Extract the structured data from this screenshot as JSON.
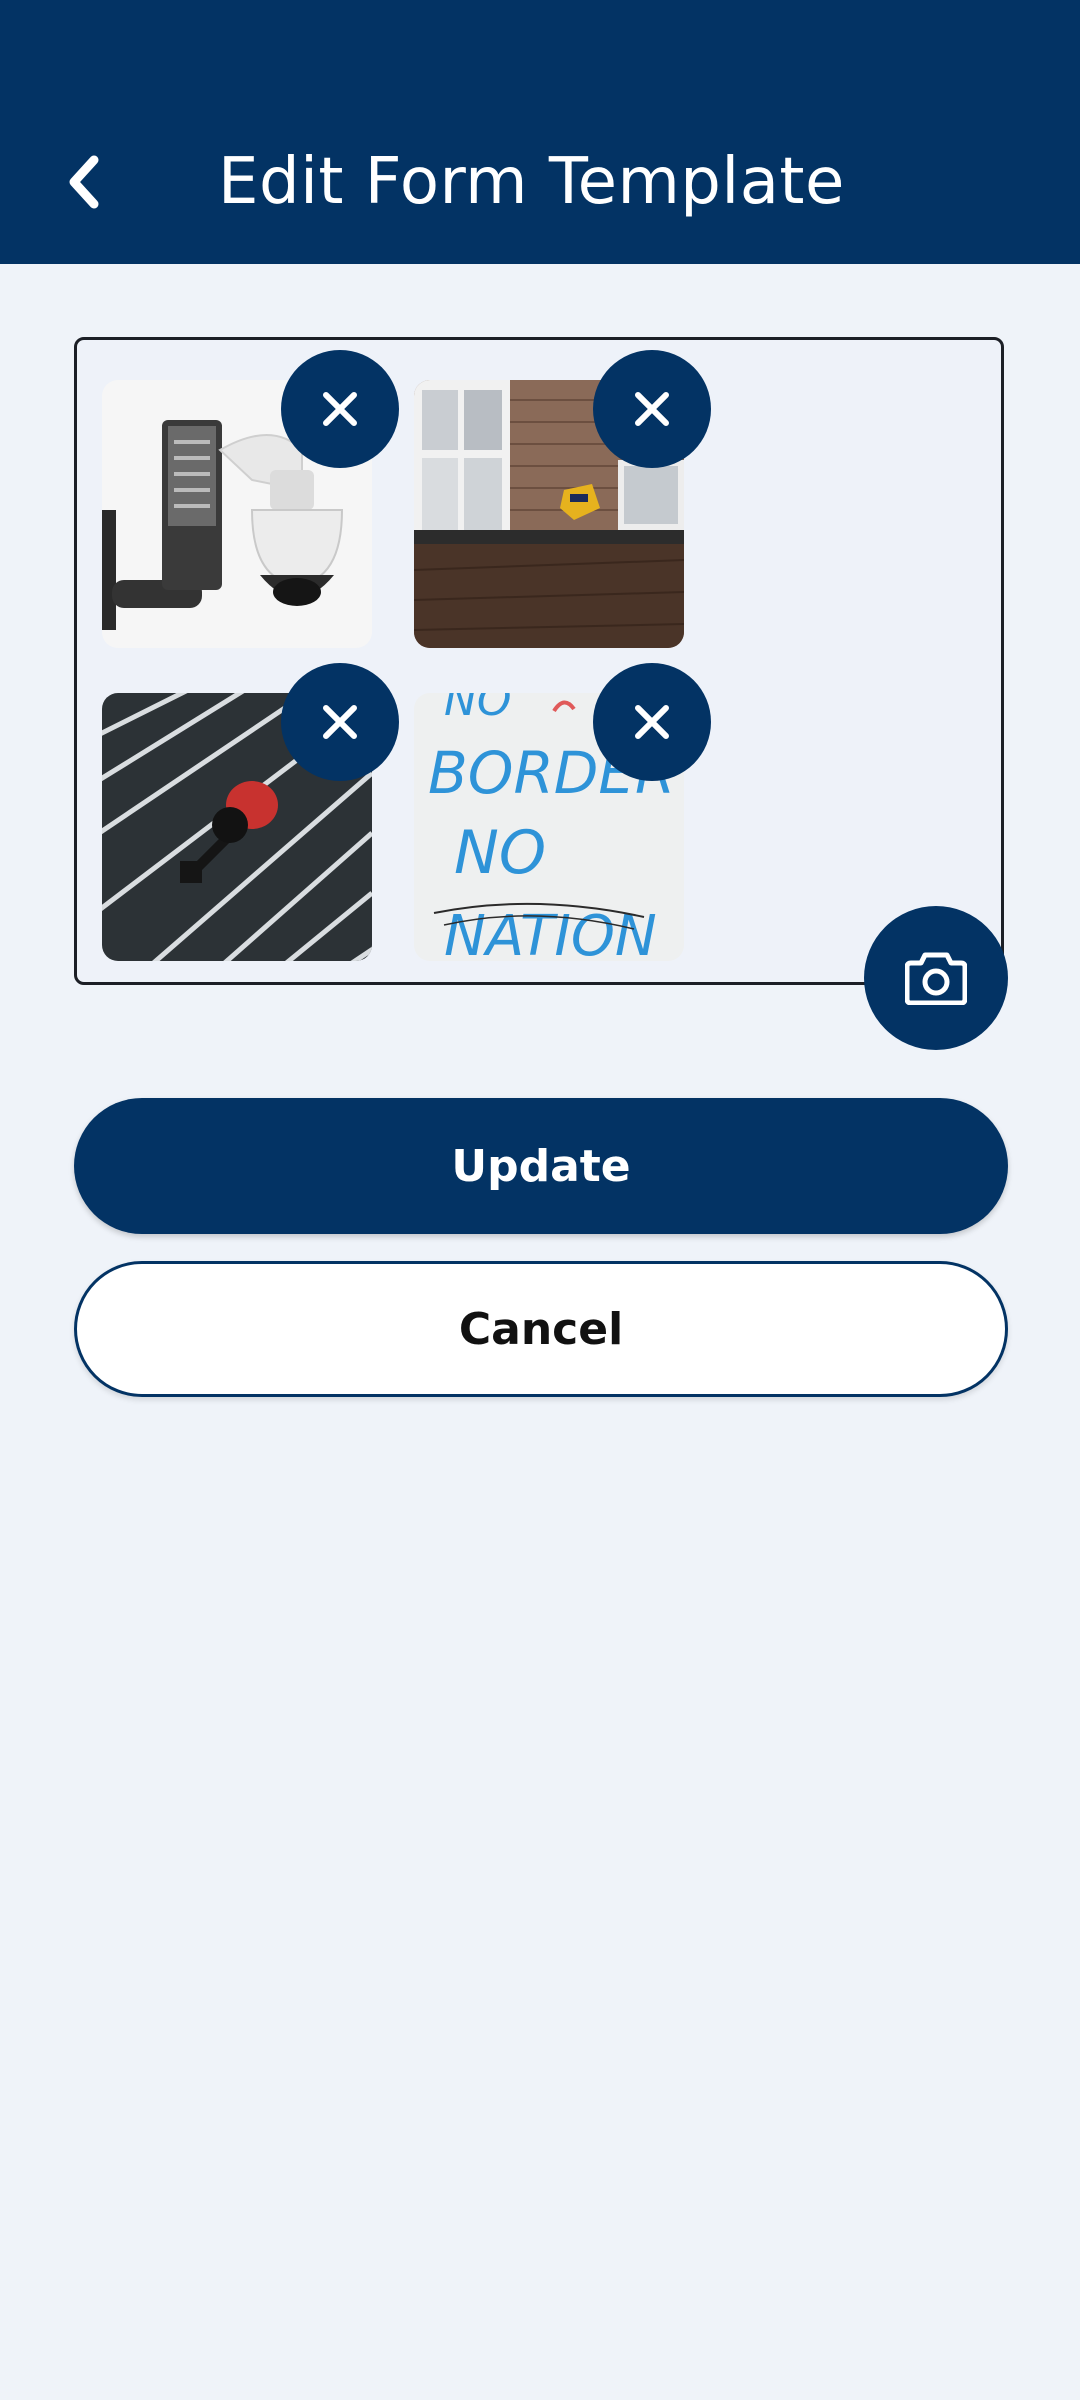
{
  "app_bar": {
    "title": "Edit Form Template",
    "back_icon": "chevron-left-icon",
    "background_color": "#033364"
  },
  "photos": {
    "items": [
      {
        "subject": "dome security camera on white background",
        "remove_icon": "close-icon"
      },
      {
        "subject": "alarm box on brick building wall",
        "remove_icon": "close-icon"
      },
      {
        "subject": "red camera mounted on ribbed metal shutter",
        "remove_icon": "close-icon"
      },
      {
        "subject": "blue graffiti on white wall",
        "remove_icon": "close-icon"
      }
    ],
    "graffiti_text": [
      "NO",
      "BORDER",
      "NO",
      "NATION"
    ],
    "add_photo_icon": "camera-icon"
  },
  "actions": {
    "update_label": "Update",
    "cancel_label": "Cancel"
  },
  "colors": {
    "primary": "#033364",
    "page_background": "#eff3f9",
    "on_primary": "#ffffff"
  }
}
